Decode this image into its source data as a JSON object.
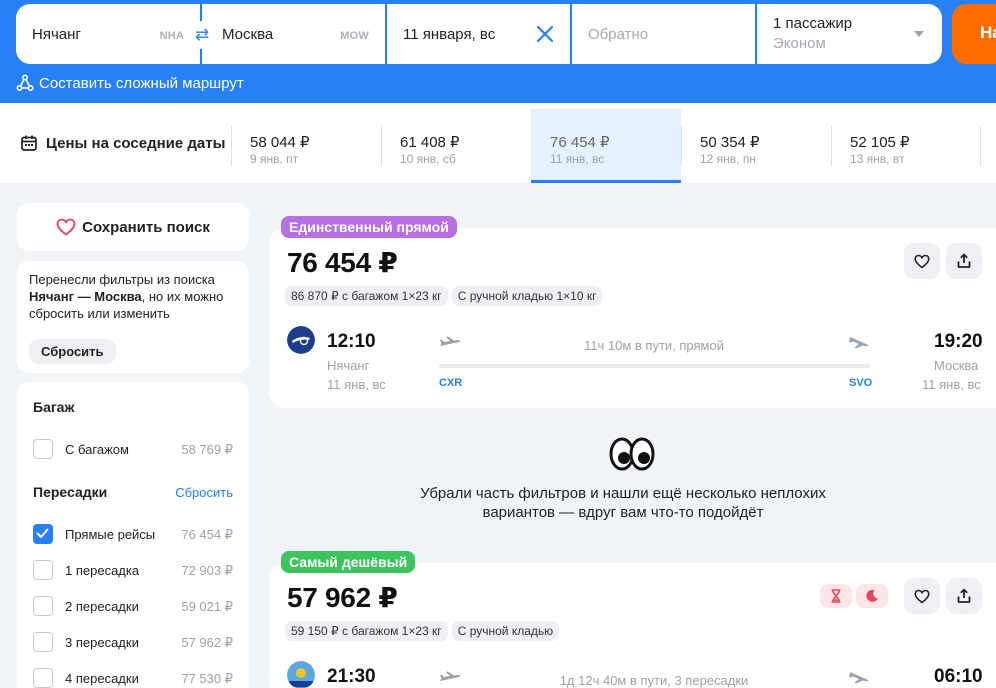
{
  "search": {
    "from_city": "Нячанг",
    "from_code": "NHA",
    "to_city": "Москва",
    "to_code": "MOW",
    "depart_date": "11 января, вс",
    "return_placeholder": "Обратно",
    "passengers": "1 пассажир",
    "cabin_class": "Эконом",
    "find_label": "На",
    "complex_route_label": "Составить сложный маршрут",
    "swap_icon": "swap-arrows-icon",
    "clear_icon": "close-icon"
  },
  "nearby_dates": {
    "title": "Цены на соседние даты",
    "items": [
      {
        "price": "58 044 ₽",
        "date": "9 янв, пт"
      },
      {
        "price": "61 408 ₽",
        "date": "10 янв, сб"
      },
      {
        "price": "76 454 ₽",
        "date": "11 янв, вс"
      },
      {
        "price": "50 354 ₽",
        "date": "12 янв, пн"
      },
      {
        "price": "52 105 ₽",
        "date": "13 янв, вт"
      }
    ],
    "active_index": 2
  },
  "sidebar": {
    "save_search": "Сохранить поиск",
    "note": {
      "line1": "Перенесли фильтры из поиска",
      "route_bold": "Нячанг — Москва",
      "line2_rest": ", но их можно",
      "line3": "сбросить или изменить",
      "reset_button": "Сбросить"
    },
    "baggage": {
      "title": "Багаж",
      "options": [
        {
          "label": "С багажом",
          "price": "58 769 ₽",
          "checked": false
        }
      ]
    },
    "transfers": {
      "title": "Пересадки",
      "reset": "Сбросить",
      "options": [
        {
          "label": "Прямые рейсы",
          "price": "76 454 ₽",
          "checked": true
        },
        {
          "label": "1 пересадка",
          "price": "72 903 ₽",
          "checked": false
        },
        {
          "label": "2 пересадки",
          "price": "59 021 ₽",
          "checked": false
        },
        {
          "label": "3 пересадки",
          "price": "57 962 ₽",
          "checked": false
        },
        {
          "label": "4 пересадки",
          "price": "77 530 ₽",
          "checked": false
        }
      ]
    }
  },
  "results": [
    {
      "badge": "Единственный прямой",
      "badge_color": "#b76fe5",
      "price": "76 454 ₽",
      "chips": [
        "86 870 ₽ с багажом 1×23 кг",
        "С ручной кладью 1×10 кг"
      ],
      "depart_time": "12:10",
      "depart_city": "Нячанг",
      "depart_date": "11 янв, вс",
      "duration": "11ч 10м в пути, прямой",
      "origin_iata": "CXR",
      "dest_iata": "SVO",
      "arrive_time": "19:20",
      "arrive_city": "Москва",
      "arrive_date": "11 янв, вс"
    },
    {
      "badge": "Самый дешёвый",
      "badge_color": "#3ec45e",
      "price": "57 962 ₽",
      "chips": [
        "59 150 ₽ с багажом 1×23 кг",
        "С ручной кладью"
      ],
      "depart_time": "21:30",
      "duration": "1д 12ч 40м в пути, 3 пересадки",
      "arrive_time": "06:10",
      "tag_icons": [
        "hourglass-icon",
        "moon-icon"
      ]
    }
  ],
  "notice": {
    "line1": "Убрали часть фильтров и нашли ещё несколько неплохих",
    "line2": "вариантов — вдруг вам что-то подойдёт"
  },
  "colors": {
    "brand_blue": "#2680f8",
    "orange": "#ff6d00",
    "purple_badge": "#b76fe5",
    "green_badge": "#3ec45e"
  }
}
